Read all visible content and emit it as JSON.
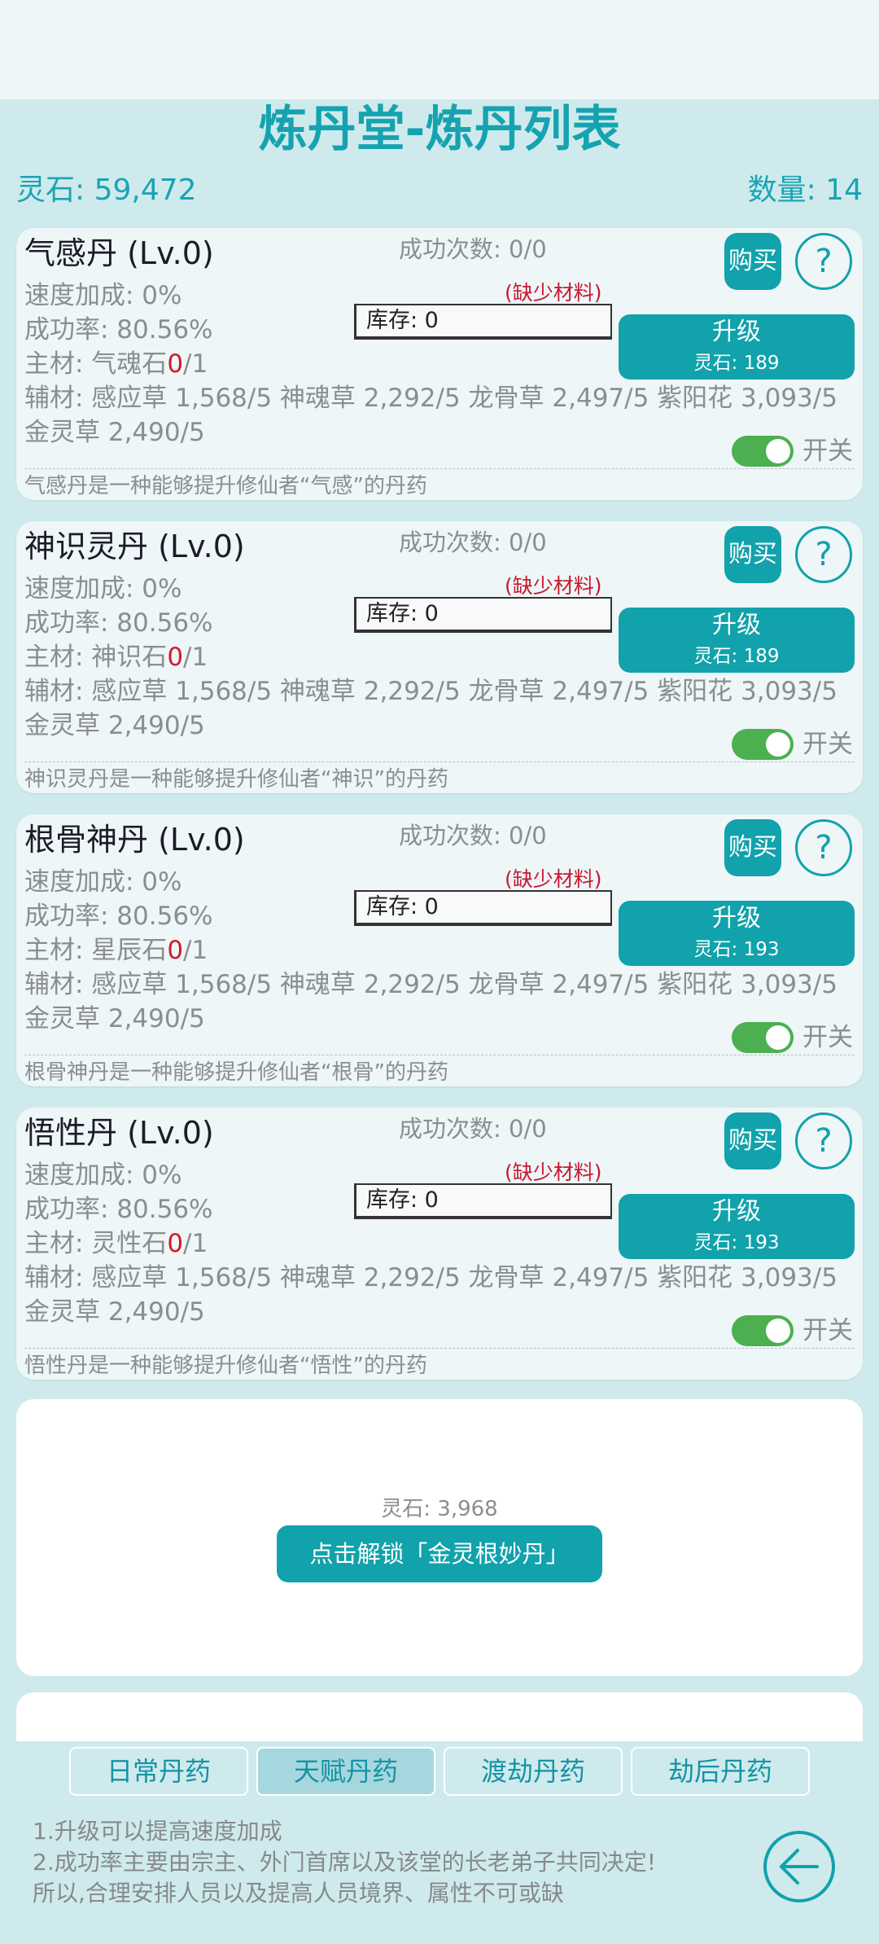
{
  "header": {
    "title": "炼丹堂-炼丹列表",
    "spirit_stones": "灵石: 59,472",
    "count": "数量: 14"
  },
  "labels": {
    "buy": "购买",
    "help": "?",
    "upgrade": "升级",
    "lack": "(缺少材料)",
    "stock": "库存: 0",
    "toggle": "开关"
  },
  "pills": [
    {
      "name": "气感丹 (Lv.0)",
      "success": "成功次数: 0/0",
      "speed": "速度加成: 0%",
      "rate": "成功率: 80.56%",
      "main_prefix": "主材: 气魂石",
      "main_have": "0",
      "main_need": "/1",
      "aux": "辅材: 感应草 1,568/5 神魂草 2,292/5 龙骨草 2,497/5 紫阳花 3,093/5",
      "aux2": "金灵草 2,490/5",
      "cost": "灵石: 189",
      "desc": "气感丹是一种能够提升修仙者“气感”的丹药"
    },
    {
      "name": "神识灵丹 (Lv.0)",
      "success": "成功次数: 0/0",
      "speed": "速度加成: 0%",
      "rate": "成功率: 80.56%",
      "main_prefix": "主材: 神识石",
      "main_have": "0",
      "main_need": "/1",
      "aux": "辅材: 感应草 1,568/5 神魂草 2,292/5 龙骨草 2,497/5 紫阳花 3,093/5",
      "aux2": "金灵草 2,490/5",
      "cost": "灵石: 189",
      "desc": "神识灵丹是一种能够提升修仙者“神识”的丹药"
    },
    {
      "name": "根骨神丹 (Lv.0)",
      "success": "成功次数: 0/0",
      "speed": "速度加成: 0%",
      "rate": "成功率: 80.56%",
      "main_prefix": "主材: 星辰石",
      "main_have": "0",
      "main_need": "/1",
      "aux": "辅材: 感应草 1,568/5 神魂草 2,292/5 龙骨草 2,497/5 紫阳花 3,093/5",
      "aux2": "金灵草 2,490/5",
      "cost": "灵石: 193",
      "desc": "根骨神丹是一种能够提升修仙者“根骨”的丹药"
    },
    {
      "name": "悟性丹 (Lv.0)",
      "success": "成功次数: 0/0",
      "speed": "速度加成: 0%",
      "rate": "成功率: 80.56%",
      "main_prefix": "主材: 灵性石",
      "main_have": "0",
      "main_need": "/1",
      "aux": "辅材: 感应草 1,568/5 神魂草 2,292/5 龙骨草 2,497/5 紫阳花 3,093/5",
      "aux2": "金灵草 2,490/5",
      "cost": "灵石: 193",
      "desc": "悟性丹是一种能够提升修仙者“悟性”的丹药"
    }
  ],
  "locked": {
    "cost": "灵石: 3,968",
    "button": "点击解锁「金灵根妙丹」"
  },
  "tabs": [
    {
      "label": "日常丹药",
      "active": false
    },
    {
      "label": "天赋丹药",
      "active": true
    },
    {
      "label": "渡劫丹药",
      "active": false
    },
    {
      "label": "劫后丹药",
      "active": false
    }
  ],
  "tips": [
    "1.升级可以提高速度加成",
    "2.成功率主要由宗主、外门首席以及该堂的长老弟子共同决定!",
    "所以,合理安排人员以及提高人员境界、属性不可或缺"
  ],
  "colors": {
    "accent": "#11a2ab",
    "missing": "#d21b2c",
    "toggle_on": "#4caf50"
  },
  "icons": {
    "help": "question-circle-icon",
    "back": "arrow-left-circle-icon"
  }
}
